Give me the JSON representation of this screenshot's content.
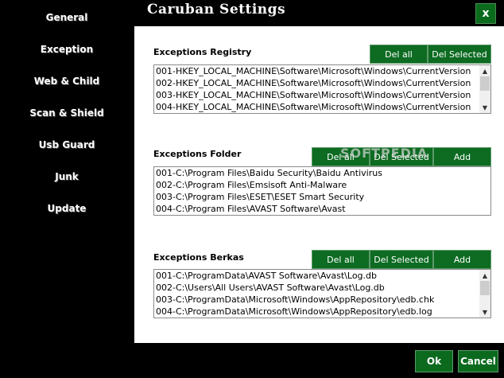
{
  "window": {
    "title": "Caruban  Settings",
    "close_label": "x"
  },
  "nav": [
    {
      "label": "General"
    },
    {
      "label": "Exception"
    },
    {
      "label": "Web & Child"
    },
    {
      "label": "Scan & Shield"
    },
    {
      "label": "Usb Guard"
    },
    {
      "label": "Junk"
    },
    {
      "label": "Update"
    }
  ],
  "registry": {
    "label": "Exceptions Registry",
    "del_all": "Del all",
    "del_selected": "Del Selected",
    "items": [
      "001-HKEY_LOCAL_MACHINE\\Software\\Microsoft\\Windows\\CurrentVersion",
      "002-HKEY_LOCAL_MACHINE\\Software\\Microsoft\\Windows\\CurrentVersion",
      "003-HKEY_LOCAL_MACHINE\\Software\\Microsoft\\Windows\\CurrentVersion",
      "004-HKEY_LOCAL_MACHINE\\Software\\Microsoft\\Windows\\CurrentVersion"
    ]
  },
  "folder": {
    "label": "Exceptions Folder",
    "del_all": "Del all",
    "del_selected": "Del Selected",
    "add": "Add",
    "items": [
      "001-C:\\Program Files\\Baidu Security\\Baidu Antivirus",
      "002-C:\\Program Files\\Emsisoft Anti-Malware",
      "003-C:\\Program Files\\ESET\\ESET Smart Security",
      "004-C:\\Program Files\\AVAST Software\\Avast"
    ]
  },
  "files": {
    "label": "Exceptions Berkas",
    "del_all": "Del all",
    "del_selected": "Del Selected",
    "add": "Add",
    "items": [
      "001-C:\\ProgramData\\AVAST Software\\Avast\\Log.db",
      "002-C:\\Users\\All Users\\AVAST Software\\Avast\\Log.db",
      "003-C:\\ProgramData\\Microsoft\\Windows\\AppRepository\\edb.chk",
      "004-C:\\ProgramData\\Microsoft\\Windows\\AppRepository\\edb.log"
    ]
  },
  "watermark": "SOFTPEDIA",
  "footer": {
    "ok": "Ok",
    "cancel": "Cancel"
  },
  "colors": {
    "button_green": "#0d6b22",
    "background": "#000000",
    "panel": "#ffffff"
  },
  "icons": {
    "scroll_up": "▲",
    "scroll_down": "▼"
  }
}
